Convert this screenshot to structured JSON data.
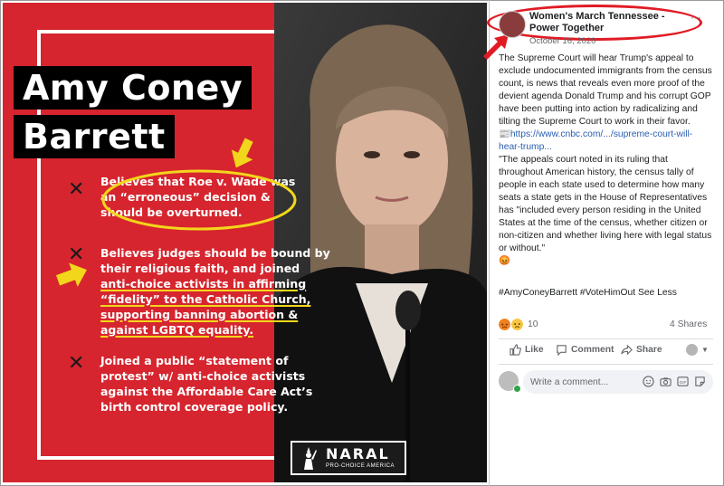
{
  "graphic": {
    "title_line1": "Amy Coney",
    "title_line2": "Barrett",
    "bullet1": "Believes that Roe v. Wade was an “erroneous” decision & should be overturned.",
    "bullet2_part1": "Believes judges should be bound by their religious faith, and joined ",
    "bullet2_part2": "anti-choice activists in affirming “fidelity” to the Catholic Church, supporting banning abortion & against LGBTQ equality.",
    "bullet3": "Joined a public “statement of protest” w/ anti-choice activists against the Affordable Care Act’s birth control coverage policy.",
    "logo_name": "NARAL",
    "logo_sub": "PRO-CHOICE AMERICA",
    "colors": {
      "background": "#d6252e",
      "highlight": "#f2d61b",
      "annotation": "#e01b24"
    },
    "bullet_icon": "x-mark-icon"
  },
  "post": {
    "page_name": "Women's March Tennessee - Power Together",
    "date": "October 16, 2020",
    "para1": "The Supreme Court will hear Trump's appeal to exclude undocumented immigrants from the census count, is news that reveals even more proof of the devient agenda Donald Trump and his corrupt GOP have been putting into action by radicalizing and tilting the Supreme Court to work in their favor.",
    "link": "https://www.cnbc.com/.../supreme-court-will-hear-trump...",
    "para2": "\"The appeals court noted in its ruling that throughout American history, the census tally of people in each state used to determine how many seats a state gets in the House of Representatives has \"included every person residing in the United States at the time of the census, whether citizen or non-citizen and whether living here with legal status or without.\"",
    "hashtags": "#AmyConeyBarrett #VoteHimOut See Less",
    "reaction_count": "10",
    "shares": "4 Shares",
    "actions": {
      "like": "Like",
      "comment": "Comment",
      "share": "Share"
    },
    "comment_placeholder": "Write a comment..."
  }
}
